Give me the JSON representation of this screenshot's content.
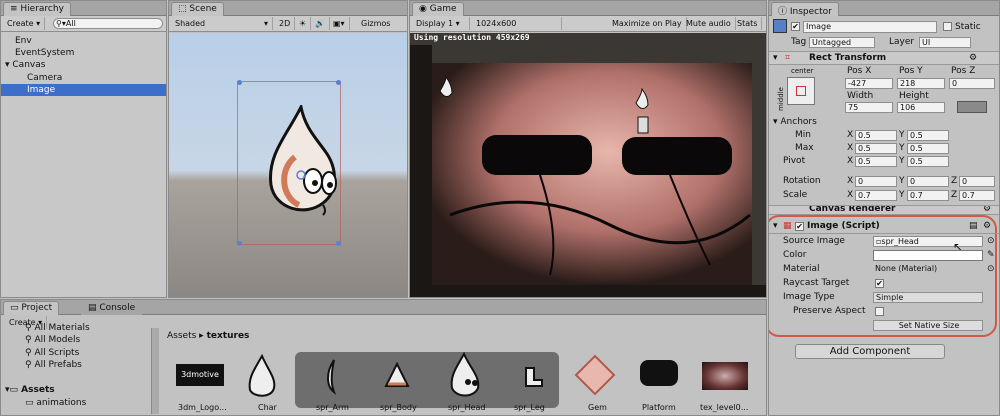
{
  "hierarchy": {
    "tab": "Hierarchy",
    "create": "Create",
    "search": "All",
    "items": [
      "Env",
      "EventSystem",
      "Canvas",
      "Camera",
      "Image"
    ]
  },
  "scene": {
    "tab": "Scene",
    "shading": "Shaded",
    "mode2d": "2D",
    "gizmos": "Gizmos"
  },
  "game": {
    "tab": "Game",
    "display": "Display 1",
    "resolution_select": "1024x600",
    "maximize": "Maximize on Play",
    "mute": "Mute audio",
    "stats": "Stats",
    "resolution_text": "Using resolution 459x269"
  },
  "inspector": {
    "tab": "Inspector",
    "object_name": "Image",
    "static_label": "Static",
    "tag_label": "Tag",
    "tag_value": "Untagged",
    "layer_label": "Layer",
    "layer_value": "UI",
    "rect_transform": {
      "title": "Rect Transform",
      "anchor_h": "center",
      "anchor_v": "middle",
      "posx_label": "Pos X",
      "posy_label": "Pos Y",
      "posz_label": "Pos Z",
      "posx": "-427",
      "posy": "218",
      "posz": "0",
      "width_label": "Width",
      "height_label": "Height",
      "width": "75",
      "height": "106"
    },
    "anchors": {
      "title": "Anchors",
      "min_label": "Min",
      "max_label": "Max",
      "pivot_label": "Pivot",
      "min_x": "0.5",
      "min_y": "0.5",
      "max_x": "0.5",
      "max_y": "0.5",
      "pivot_x": "0.5",
      "pivot_y": "0.5"
    },
    "rotation": {
      "label": "Rotation",
      "x": "0",
      "y": "0",
      "z": "0"
    },
    "scale": {
      "label": "Scale",
      "x": "0.7",
      "y": "0.7",
      "z": "0.7"
    },
    "canvas_renderer": "Canvas Renderer",
    "image_script": {
      "title": "Image (Script)",
      "source_label": "Source Image",
      "source_value": "spr_Head",
      "color_label": "Color",
      "material_label": "Material",
      "material_value": "None (Material)",
      "raycast_label": "Raycast Target",
      "image_type_label": "Image Type",
      "image_type_value": "Simple",
      "preserve_label": "Preserve Aspect",
      "set_native": "Set Native Size"
    },
    "add_component": "Add Component",
    "axis": {
      "x": "X",
      "y": "Y",
      "z": "Z"
    }
  },
  "project": {
    "tab_project": "Project",
    "tab_console": "Console",
    "create": "Create",
    "favorites": [
      "All Materials",
      "All Models",
      "All Scripts",
      "All Prefabs"
    ],
    "assets_root": "Assets",
    "assets_child": "animations",
    "breadcrumb_root": "Assets",
    "breadcrumb_sep": "▸",
    "breadcrumb_current": "textures",
    "thumbnails": [
      "3dm_Logo...",
      "Char",
      "spr_Arm",
      "spr_Body",
      "spr_Head",
      "spr_Leg",
      "Gem",
      "Platform",
      "tex_level0..."
    ],
    "logo_text": "3dmotive"
  }
}
